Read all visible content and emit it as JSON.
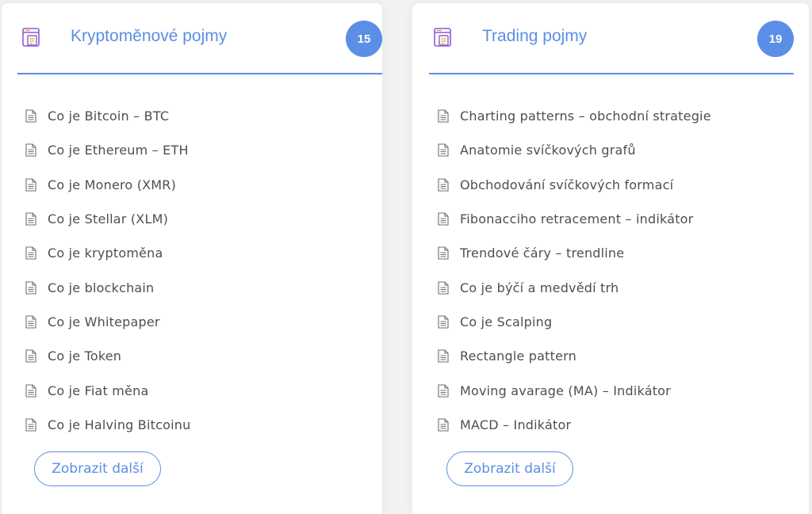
{
  "colors": {
    "accent": "#5b8ee6",
    "icon_purple": "#8a5bd6",
    "text": "#4a4f57",
    "background": "#f1f2f4"
  },
  "crypto": {
    "icon": "folder-document-icon",
    "title": "Kryptoměnové pojmy",
    "count": "15",
    "items": [
      "Co je Bitcoin – BTC",
      "Co je Ethereum – ETH",
      "Co je Monero (XMR)",
      "Co je Stellar (XLM)",
      "Co je kryptoměna",
      "Co je blockchain",
      "Co je Whitepaper",
      "Co je Token",
      "Co je Fiat měna",
      "Co je Halving Bitcoinu"
    ],
    "more_label": "Zobrazit další"
  },
  "trading": {
    "icon": "folder-document-icon",
    "title": "Trading pojmy",
    "count": "19",
    "items": [
      "Charting patterns – obchodní strategie",
      "Anatomie svíčkových grafů",
      "Obchodování svíčkových formací",
      "Fibonacciho retracement – indikátor",
      "Trendové čáry – trendline",
      "Co je býčí a medvědí trh",
      "Co je Scalping",
      "Rectangle pattern",
      "Moving avarage (MA) – Indikátor",
      "MACD – Indikátor"
    ],
    "more_label": "Zobrazit další"
  }
}
